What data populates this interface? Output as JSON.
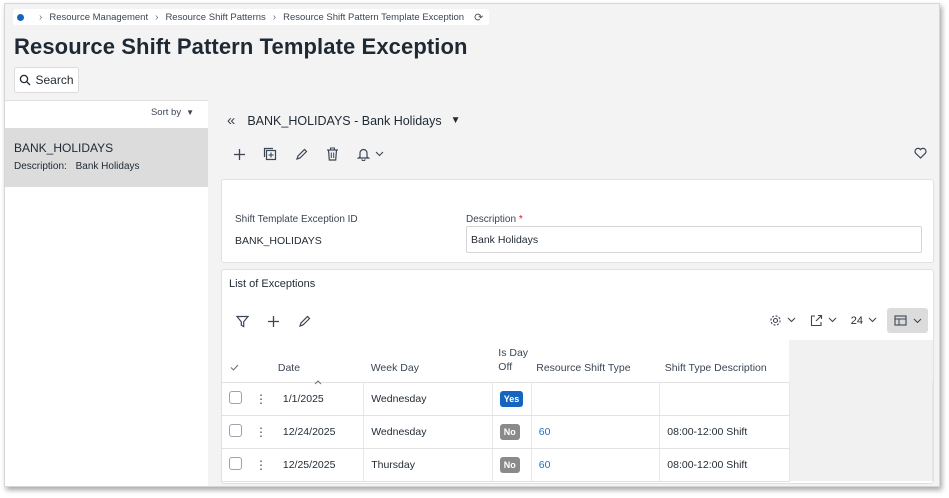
{
  "breadcrumb": {
    "items": [
      "Resource Management",
      "Resource Shift Patterns",
      "Resource Shift Pattern Template Exception"
    ]
  },
  "page": {
    "title": "Resource Shift Pattern Template Exception",
    "search_label": "Search"
  },
  "left_panel": {
    "sort_by_label": "Sort by",
    "item": {
      "title": "BANK_HOLIDAYS",
      "desc_label": "Description:",
      "desc_value": "Bank Holidays"
    }
  },
  "record": {
    "header": "BANK_HOLIDAYS - Bank Holidays"
  },
  "form": {
    "id_label": "Shift Template Exception ID",
    "id_value": "BANK_HOLIDAYS",
    "desc_label": "Description",
    "desc_required": "*",
    "desc_value": "Bank Holidays"
  },
  "exceptions": {
    "title": "List of Exceptions",
    "page_size": "24",
    "columns": {
      "date": "Date",
      "week_day": "Week Day",
      "is_day_off_1": "Is Day",
      "is_day_off_2": "Off",
      "shift_type": "Resource Shift Type",
      "shift_desc": "Shift Type Description"
    },
    "rows": [
      {
        "date": "1/1/2025",
        "week_day": "Wednesday",
        "day_off": "Yes",
        "shift_type": "",
        "shift_desc": ""
      },
      {
        "date": "12/24/2025",
        "week_day": "Wednesday",
        "day_off": "No",
        "shift_type": "60",
        "shift_desc": "08:00-12:00 Shift"
      },
      {
        "date": "12/25/2025",
        "week_day": "Thursday",
        "day_off": "No",
        "shift_type": "60",
        "shift_desc": "08:00-12:00 Shift"
      }
    ]
  },
  "colors": {
    "accent": "#1565c0",
    "link": "#1f6fc5",
    "required": "#d11a2a",
    "pill_no": "#8a8a8a"
  }
}
